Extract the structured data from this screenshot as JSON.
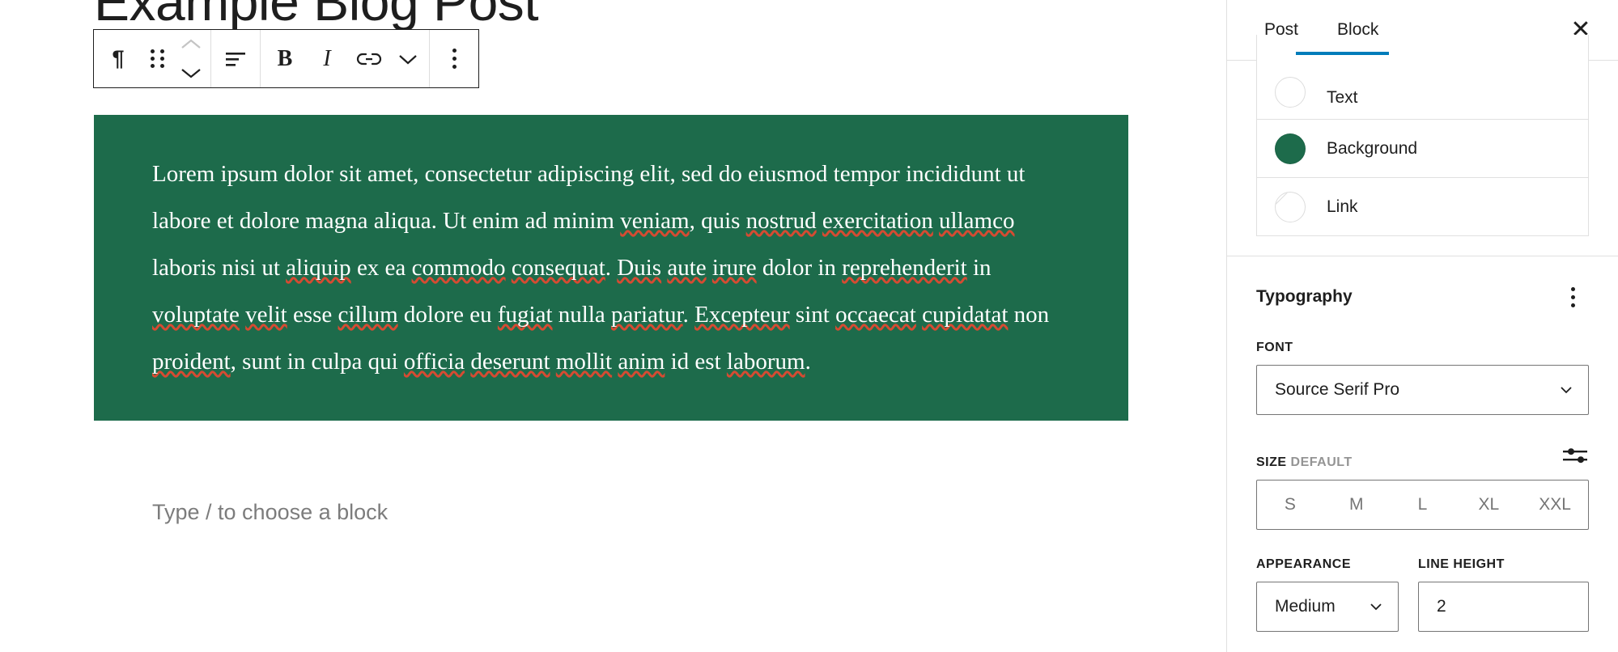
{
  "editor": {
    "post_title": "Example Blog Post",
    "paragraph_text": "Lorem ipsum dolor sit amet, consectetur adipiscing elit, sed do eiusmod tempor incididunt ut labore et dolore magna aliqua. Ut enim ad minim veniam, quis nostrud exercitation ullamco laboris nisi ut aliquip ex ea commodo consequat. Duis aute irure dolor in reprehenderit in voluptate velit esse cillum dolore eu fugiat nulla pariatur. Excepteur sint occaecat cupidatat non proident, sunt in culpa qui officia deserunt mollit anim id est laborum.",
    "empty_block_placeholder": "Type / to choose a block",
    "paragraph_background_color": "#1d6b4b",
    "paragraph_text_color": "#ffffff"
  },
  "toolbar": {
    "block_type_icon": "paragraph-icon",
    "block_type_glyph": "¶",
    "drag_handle_icon": "drag-handle-icon",
    "move_up_icon": "chevron-up-icon",
    "move_down_icon": "chevron-down-icon",
    "align_icon": "align-left-icon",
    "bold_label": "B",
    "italic_label": "I",
    "link_icon": "link-icon",
    "more_rich_text_icon": "chevron-down-icon",
    "options_icon": "three-dots-vertical-icon"
  },
  "sidebar": {
    "tabs": [
      {
        "label": "Post",
        "active": false
      },
      {
        "label": "Block",
        "active": true
      }
    ],
    "close_icon": "close-icon",
    "close_glyph": "✕",
    "active_tab_indicator_color": "#007cba",
    "color_panel": {
      "rows": [
        {
          "label": "Text",
          "swatch": "empty",
          "color": ""
        },
        {
          "label": "Background",
          "swatch": "filled",
          "color": "#1d6b4b"
        },
        {
          "label": "Link",
          "swatch": "none",
          "color": ""
        }
      ]
    },
    "typography": {
      "title": "Typography",
      "options_icon": "three-dots-vertical-icon",
      "font_label": "FONT",
      "font_value": "Source Serif Pro",
      "font_chevron_icon": "chevron-down-icon",
      "size_label": "SIZE",
      "size_value_label": "DEFAULT",
      "size_settings_icon": "sliders-icon",
      "size_options": [
        "S",
        "M",
        "L",
        "XL",
        "XXL"
      ],
      "appearance_label": "APPEARANCE",
      "appearance_value": "Medium",
      "appearance_chevron_icon": "chevron-down-icon",
      "line_height_label": "LINE HEIGHT",
      "line_height_value": "2"
    }
  }
}
